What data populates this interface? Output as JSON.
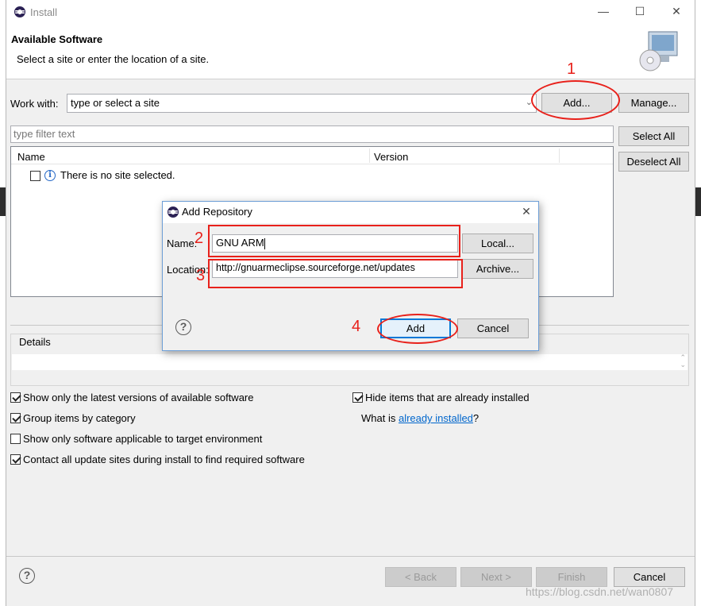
{
  "window": {
    "title": "Install",
    "controls": {
      "minimize": "—",
      "maximize": "☐",
      "close": "✕"
    }
  },
  "header": {
    "title": "Available Software",
    "subtitle": "Select a site or enter the location of a site."
  },
  "work_with": {
    "label": "Work with:",
    "placeholder": "type or select a site",
    "add_button": "Add...",
    "manage_button": "Manage..."
  },
  "filter": {
    "placeholder": "type filter text"
  },
  "side_buttons": {
    "select_all": "Select All",
    "deselect_all": "Deselect All"
  },
  "table": {
    "columns": [
      "Name",
      "Version"
    ],
    "rows": [
      {
        "text": "There is no site selected.",
        "checked": false
      }
    ]
  },
  "details": {
    "label": "Details"
  },
  "options": {
    "left": [
      {
        "label": "Show only the latest versions of available software",
        "checked": true
      },
      {
        "label": "Group items by category",
        "checked": true
      },
      {
        "label": "Show only software applicable to target environment",
        "checked": false
      },
      {
        "label": "Contact all update sites during install to find required software",
        "checked": true
      }
    ],
    "hide_installed": {
      "label": "Hide items that are already installed",
      "checked": true
    },
    "what_is_prefix": "What is ",
    "what_is_link": "already installed",
    "what_is_suffix": "?"
  },
  "footer": {
    "back": "< Back",
    "next": "Next >",
    "finish": "Finish",
    "cancel": "Cancel"
  },
  "dialog": {
    "title": "Add Repository",
    "name_label": "Name:",
    "name_value": "GNU ARM",
    "location_label": "Location:",
    "location_value": "http://gnuarmeclipse.sourceforge.net/updates",
    "local_button": "Local...",
    "archive_button": "Archive...",
    "add_button": "Add",
    "cancel_button": "Cancel",
    "close": "✕"
  },
  "annotations": {
    "step1": "1",
    "step2": "2",
    "step3": "3",
    "step4": "4",
    "color": "#e8211b"
  },
  "watermark": "https://blog.csdn.net/wan0807"
}
